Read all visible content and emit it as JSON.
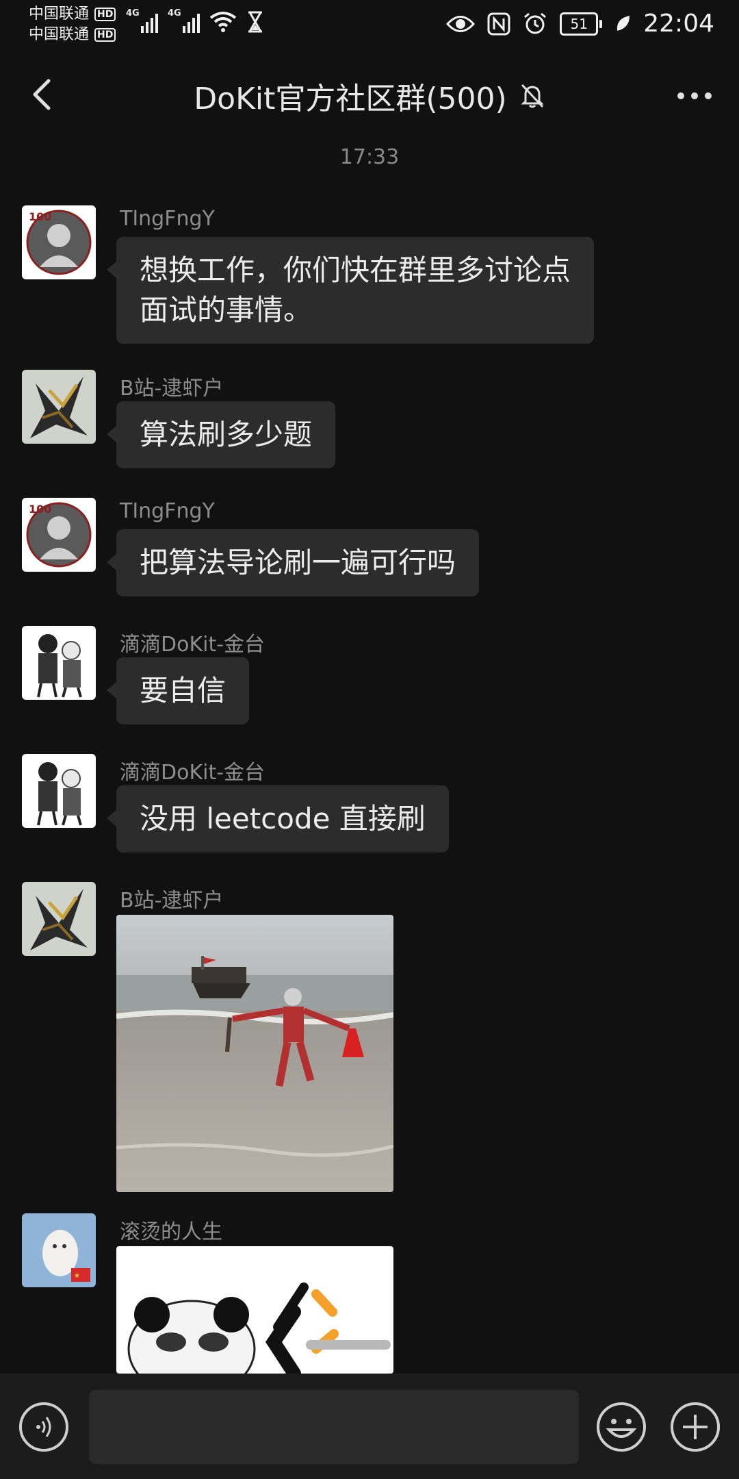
{
  "status_bar": {
    "carrier_1": "中国联通",
    "carrier_2": "中国联通",
    "hd_label": "HD",
    "net_1": "4G",
    "net_2": "4G",
    "battery": "51",
    "time": "22:04"
  },
  "header": {
    "title": "DoKit官方社区群(500)"
  },
  "chat": {
    "timestamp": "17:33",
    "messages": [
      {
        "sender": "TIngFngY",
        "text_line1": "想换工作，你们快在群里多讨论点",
        "text_line2": "面试的事情。"
      },
      {
        "sender": "B站-逮虾户",
        "text": "算法刷多少题"
      },
      {
        "sender": "TIngFngY",
        "text": "把算法导论刷一遍可行吗"
      },
      {
        "sender": "滴滴DoKit-金台",
        "text": "要自信"
      },
      {
        "sender": "滴滴DoKit-金台",
        "text": "没用 leetcode 直接刷"
      },
      {
        "sender": "B站-逮虾户",
        "image": "beach-meme-image"
      },
      {
        "sender": "滚烫的人生",
        "image": "panda-sticker-image"
      }
    ]
  },
  "input_bar": {
    "input_value": "",
    "voice_icon": "voice-icon",
    "emoji_icon": "emoji-icon",
    "plus_icon": "plus-icon"
  },
  "colors": {
    "background": "#111111",
    "bubble": "#2c2c2c",
    "sender": "#8d8d8d",
    "input_bar": "#1c1c1c"
  }
}
